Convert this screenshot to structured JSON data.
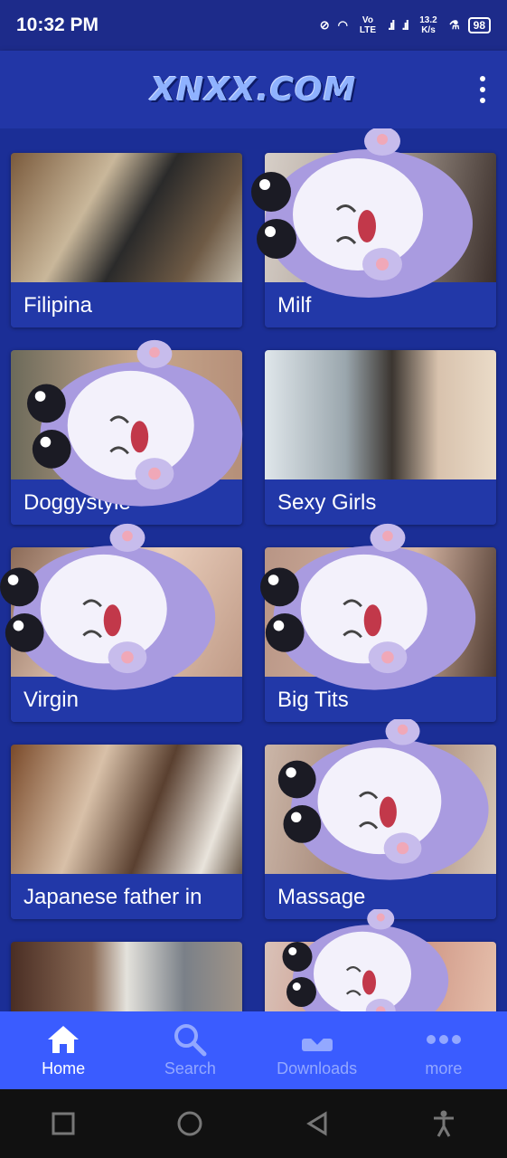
{
  "status_bar": {
    "time": "10:32 PM",
    "network": "Vo LTE",
    "speed": "13.2 K/s",
    "battery": "98"
  },
  "header": {
    "logo": "XNXX.COM",
    "menu_icon": "more-vert-icon"
  },
  "categories": [
    {
      "label": "Filipina"
    },
    {
      "label": "Milf"
    },
    {
      "label": "Doggystyle"
    },
    {
      "label": "Sexy Girls"
    },
    {
      "label": "Virgin"
    },
    {
      "label": "Big Tits"
    },
    {
      "label": "Japanese father in"
    },
    {
      "label": "Massage"
    },
    {
      "label": ""
    },
    {
      "label": ""
    }
  ],
  "bottom_nav": {
    "items": [
      {
        "label": "Home",
        "icon": "home-icon",
        "active": true
      },
      {
        "label": "Search",
        "icon": "search-icon",
        "active": false
      },
      {
        "label": "Downloads",
        "icon": "download-icon",
        "active": false
      },
      {
        "label": "more",
        "icon": "more-horiz-icon",
        "active": false
      }
    ]
  },
  "colors": {
    "background": "#1b2e96",
    "header": "#2236a6",
    "card": "#2238a8",
    "bottom_nav": "#3a5cff",
    "nav_inactive": "#93a8ff"
  }
}
